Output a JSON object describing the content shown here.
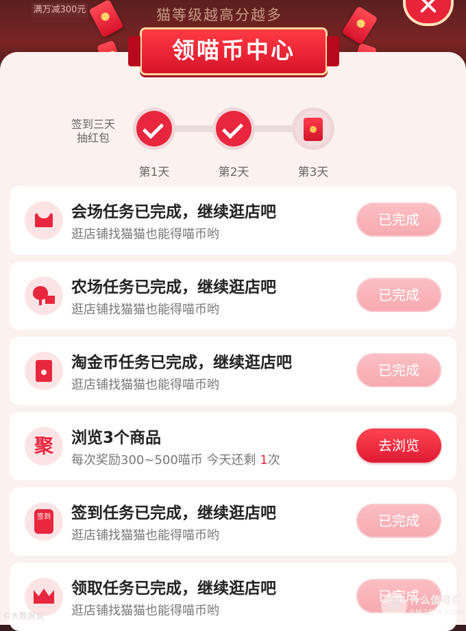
{
  "backdrop": {
    "promo_tag": "满万减300元",
    "banner_text": "猫等级越高分越多"
  },
  "title": "领喵币中心",
  "signin": {
    "label": "签到三天\n抽红包",
    "days": [
      {
        "label": "第1天",
        "state": "checked"
      },
      {
        "label": "第2天",
        "state": "checked"
      },
      {
        "label": "第3天",
        "state": "gift"
      }
    ]
  },
  "tasks": [
    {
      "icon": "shop-icon",
      "title": "会场任务已完成，继续逛店吧",
      "subtitle": "逛店铺找猫猫也能得喵币哟",
      "button": "已完成",
      "state": "done"
    },
    {
      "icon": "farm-icon",
      "title": "农场任务已完成，继续逛店吧",
      "subtitle": "逛店铺找猫猫也能得喵币哟",
      "button": "已完成",
      "state": "done"
    },
    {
      "icon": "red-envelope-icon",
      "title": "淘金币任务已完成，继续逛店吧",
      "subtitle": "逛店铺找猫猫也能得喵币哟",
      "button": "已完成",
      "state": "done"
    },
    {
      "icon": "ju-icon",
      "title": "浏览3个商品",
      "subtitle_prefix": "每次奖励300~500喵币 今天还剩 ",
      "subtitle_count": "1",
      "subtitle_suffix": "次",
      "button": "去浏览",
      "state": "go"
    },
    {
      "icon": "sign-in-icon",
      "title": "签到任务已完成，继续逛店吧",
      "subtitle": "逛店铺找猫猫也能得喵币哟",
      "button": "已完成",
      "state": "done"
    },
    {
      "icon": "crown-icon",
      "title": "领取任务已完成，继续逛店吧",
      "subtitle": "逛店铺找猫猫也能得喵币哟",
      "button": "已完成",
      "state": "done"
    }
  ],
  "icon_glyphs": {
    "ju": "聚",
    "sign": "签到"
  },
  "watermarks": {
    "left": "©大数据说",
    "right_glyph": "值",
    "right_cn": "什么值得买",
    "right_en": "SMZDM.COM"
  },
  "colors": {
    "accent": "#e8263d",
    "done_button": "#f6a9b0",
    "panel_bg": "#fbf1ef"
  }
}
